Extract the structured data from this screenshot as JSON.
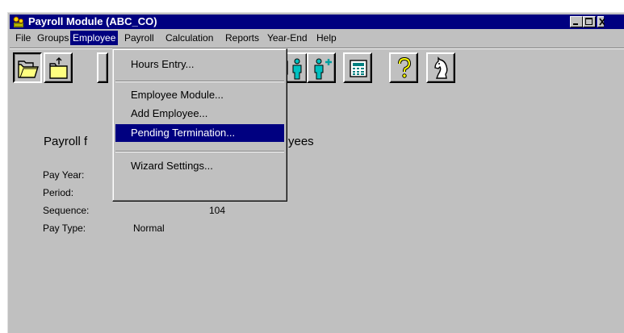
{
  "window": {
    "title": "Payroll Module  (ABC_CO)"
  },
  "menubar": {
    "items": [
      {
        "label": "File"
      },
      {
        "label": "Groups"
      },
      {
        "label": "Employee"
      },
      {
        "label": "Payroll"
      },
      {
        "label": "Calculation"
      },
      {
        "label": "Reports"
      },
      {
        "label": "Year-End"
      },
      {
        "label": "Help"
      }
    ],
    "active": "Employee"
  },
  "toolbar": {
    "buttons": [
      {
        "icon": "open-folder-icon"
      },
      {
        "icon": "folder-up-icon"
      },
      {
        "icon": "employee-list-icon"
      },
      {
        "icon": "add-employee-icon"
      },
      {
        "icon": "calculator-icon"
      },
      {
        "icon": "help-icon"
      },
      {
        "icon": "wizard-knight-icon"
      }
    ]
  },
  "employee_menu": {
    "items": [
      {
        "label": "Hours Entry..."
      },
      {
        "label": "Employee Module..."
      },
      {
        "label": "Add Employee..."
      },
      {
        "label": "Pending Termination..."
      },
      {
        "label": "Wizard Settings..."
      }
    ],
    "highlighted": "Pending Termination..."
  },
  "main": {
    "heading_start": "Payroll f",
    "heading_end": "yees",
    "fields": [
      {
        "label": "Pay Year:",
        "value": ""
      },
      {
        "label": "Period:",
        "value": ""
      },
      {
        "label": "Sequence:",
        "value": "104"
      },
      {
        "label": "Pay Type:",
        "value": "Normal"
      }
    ]
  },
  "colors": {
    "titlebar": "#000080",
    "face": "#c0c0c0",
    "highlight": "#000080"
  }
}
